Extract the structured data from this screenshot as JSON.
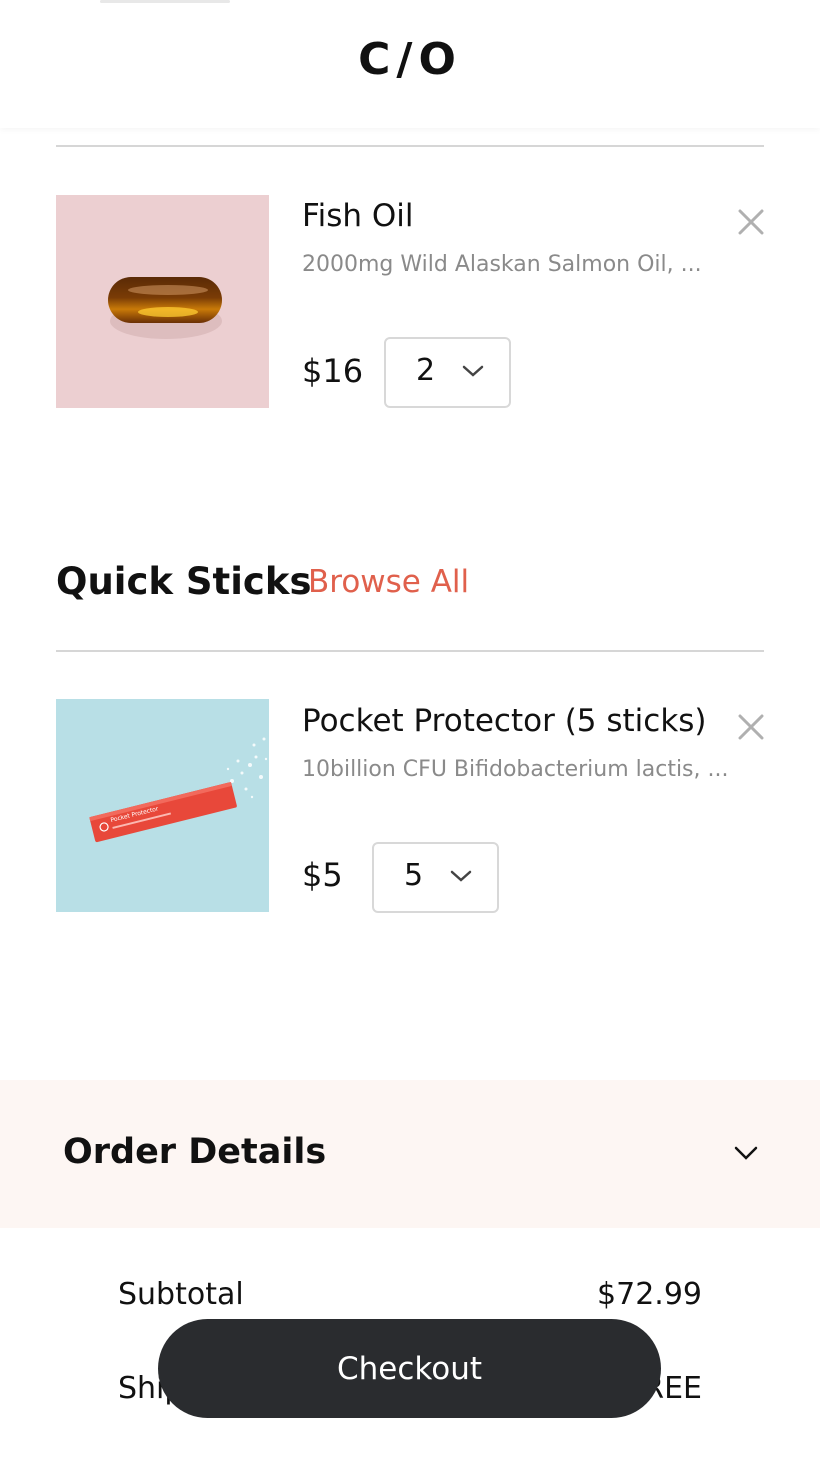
{
  "header": {
    "logo": "C/O"
  },
  "cart": {
    "items": [
      {
        "name": "Fish Oil",
        "description": "2000mg Wild Alaskan Salmon Oil, ...",
        "price": "$16",
        "quantity": "2"
      }
    ]
  },
  "quick_sticks": {
    "title": "Quick Sticks",
    "browse_label": "Browse All",
    "items": [
      {
        "name": "Pocket Protector (5 sticks)",
        "description": "10billion CFU Bifidobacterium lactis, ...",
        "price": "$5",
        "quantity": "5",
        "packet_label": "Pocket Protector"
      }
    ]
  },
  "order_details": {
    "title": "Order Details",
    "subtotal_label": "Subtotal",
    "subtotal_value": "$72.99",
    "shipping_label": "Shipping",
    "shipping_value": "FREE"
  },
  "checkout": {
    "label": "Checkout"
  },
  "colors": {
    "accent": "#e0604c",
    "checkout_bg": "#2a2c2f",
    "order_bar_bg": "#fdf6f3"
  }
}
